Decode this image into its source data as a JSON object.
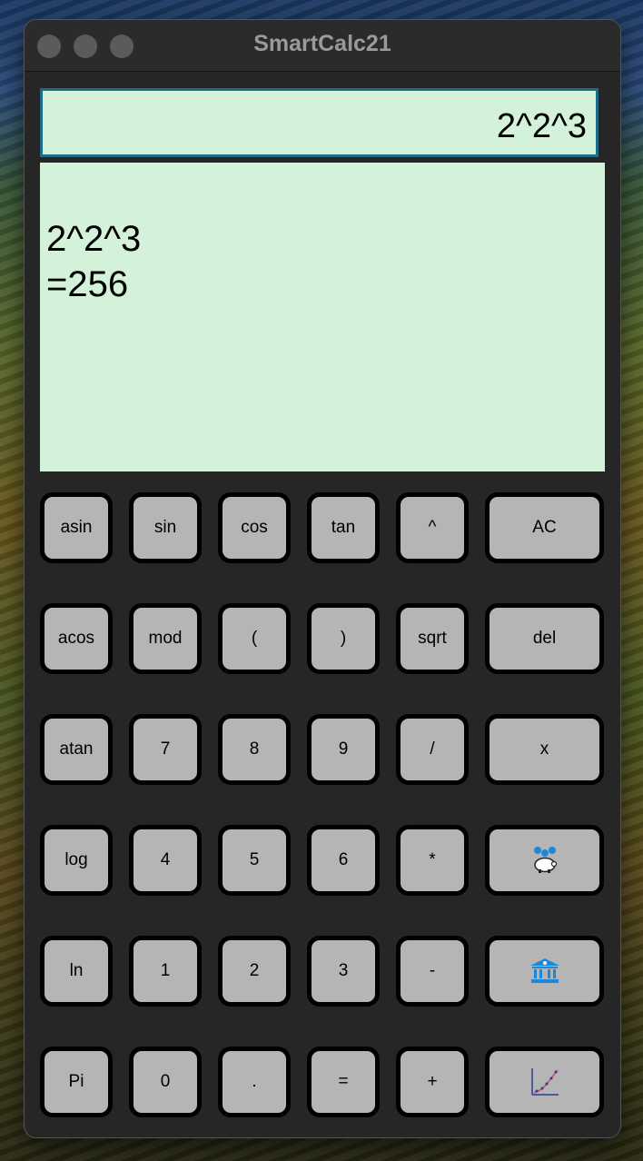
{
  "window": {
    "title": "SmartCalc21"
  },
  "display": {
    "input_value": "2^2^3",
    "output_lines": [
      "2^2^3",
      "=256"
    ]
  },
  "buttons": [
    [
      "asin",
      "sin",
      "cos",
      "tan",
      "^",
      "AC"
    ],
    [
      "acos",
      "mod",
      "(",
      ")",
      "sqrt",
      "del"
    ],
    [
      "atan",
      "7",
      "8",
      "9",
      "/",
      "x"
    ],
    [
      "log",
      "4",
      "5",
      "6",
      "*",
      "deposit-calculator-icon"
    ],
    [
      "ln",
      "1",
      "2",
      "3",
      "-",
      "credit-calculator-icon"
    ],
    [
      "Pi",
      "0",
      ".",
      "=",
      "+",
      "graph-plot-icon"
    ]
  ],
  "colors": {
    "display_bg": "#d4f2da",
    "display_border": "#1b6e86",
    "button_bg": "#b5b5b5",
    "window_bg": "#262626"
  }
}
